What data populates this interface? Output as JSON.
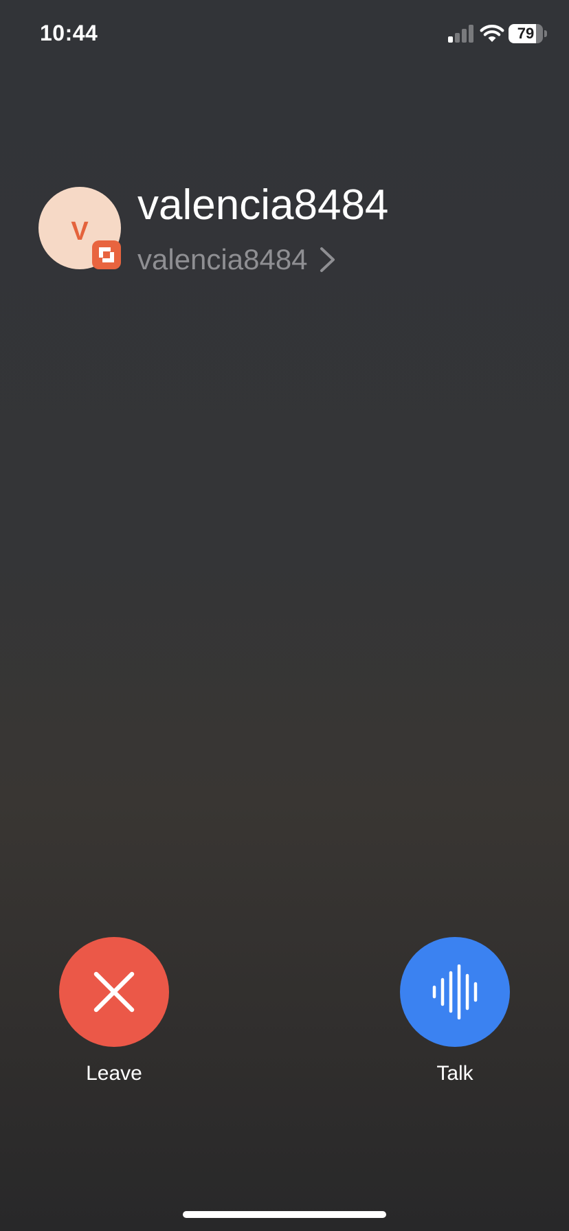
{
  "status_bar": {
    "time": "10:44",
    "battery_level": "79",
    "battery_fraction": 0.79
  },
  "contact": {
    "avatar_initial": "V",
    "name": "valencia8484",
    "handle": "valencia8484",
    "avatar_color": "#f6d9c6",
    "initial_color": "#e4633c",
    "badge_color": "#e8643f",
    "badge_icon": "app-badge-icon"
  },
  "actions": {
    "leave_label": "Leave",
    "leave_color": "#eb5848",
    "leave_icon": "close-icon",
    "talk_label": "Talk",
    "talk_color": "#3b82f1",
    "talk_icon": "waveform-icon"
  }
}
